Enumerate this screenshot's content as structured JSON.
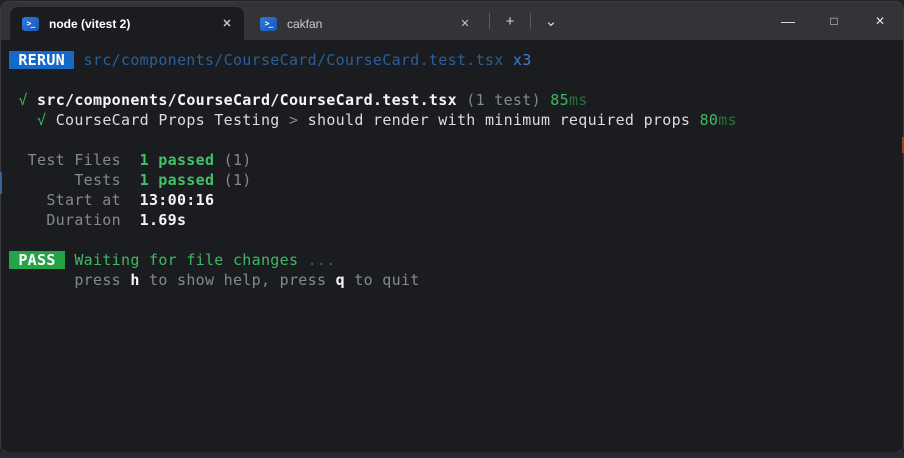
{
  "window": {
    "tabs": [
      {
        "title": "node (vitest 2)",
        "active": true
      },
      {
        "title": "cakfan",
        "active": false
      }
    ]
  },
  "icons": {
    "terminal_glyph": ">_",
    "tab_close": "✕",
    "new_tab": "+",
    "tab_dropdown": "⌄",
    "minimize": "—",
    "maximize": "□",
    "window_close": "✕"
  },
  "colors": {
    "rerun_badge_blue": "#1569c8",
    "pass_badge_green": "#27a347",
    "success_green": "#3fb862",
    "terminal_background": "#1b1c1f",
    "titlebar_background": "#333338"
  },
  "terminal": {
    "lines": [
      {
        "segments": [
          {
            "text": " RERUN ",
            "style": "badge-rerun"
          },
          {
            "text": " ",
            "style": "plain"
          },
          {
            "text": "src/components/CourseCard/CourseCard.test.tsx",
            "style": "blue-dim"
          },
          {
            "text": " ",
            "style": "plain"
          },
          {
            "text": "x3",
            "style": "blue"
          }
        ]
      },
      {
        "segments": []
      },
      {
        "segments": [
          {
            "text": " ",
            "style": "plain"
          },
          {
            "text": "√",
            "style": "green"
          },
          {
            "text": " ",
            "style": "plain"
          },
          {
            "text": "src/components/CourseCard/CourseCard.test.tsx",
            "style": "white-bold"
          },
          {
            "text": " ",
            "style": "plain"
          },
          {
            "text": "(1 test)",
            "style": "gray"
          },
          {
            "text": " ",
            "style": "plain"
          },
          {
            "text": "85",
            "style": "green"
          },
          {
            "text": "ms",
            "style": "green-dim"
          }
        ]
      },
      {
        "segments": [
          {
            "text": "   ",
            "style": "plain"
          },
          {
            "text": "√",
            "style": "green"
          },
          {
            "text": " ",
            "style": "plain"
          },
          {
            "text": "CourseCard Props Testing",
            "style": "white"
          },
          {
            "text": " ",
            "style": "plain"
          },
          {
            "text": ">",
            "style": "gray"
          },
          {
            "text": " ",
            "style": "plain"
          },
          {
            "text": "should render with minimum required props",
            "style": "white"
          },
          {
            "text": " ",
            "style": "plain"
          },
          {
            "text": "80",
            "style": "green"
          },
          {
            "text": "ms",
            "style": "green-dim"
          }
        ]
      },
      {
        "segments": []
      },
      {
        "segments": [
          {
            "text": "  Test Files  ",
            "style": "gray"
          },
          {
            "text": "1 passed",
            "style": "green-bold"
          },
          {
            "text": " ",
            "style": "plain"
          },
          {
            "text": "(1)",
            "style": "gray"
          }
        ]
      },
      {
        "segments": [
          {
            "text": "       Tests  ",
            "style": "gray"
          },
          {
            "text": "1 passed",
            "style": "green-bold"
          },
          {
            "text": " ",
            "style": "plain"
          },
          {
            "text": "(1)",
            "style": "gray"
          }
        ]
      },
      {
        "segments": [
          {
            "text": "    Start at  ",
            "style": "gray"
          },
          {
            "text": "13:00:16",
            "style": "white-bold"
          }
        ]
      },
      {
        "segments": [
          {
            "text": "    Duration  ",
            "style": "gray"
          },
          {
            "text": "1.69s",
            "style": "white-bold"
          }
        ]
      },
      {
        "segments": []
      },
      {
        "segments": [
          {
            "text": " PASS ",
            "style": "badge-pass"
          },
          {
            "text": " ",
            "style": "plain"
          },
          {
            "text": "Waiting for file changes",
            "style": "green"
          },
          {
            "text": " ...",
            "style": "green-dim"
          }
        ]
      },
      {
        "segments": [
          {
            "text": "       ",
            "style": "plain"
          },
          {
            "text": "press ",
            "style": "gray"
          },
          {
            "text": "h",
            "style": "white-bold"
          },
          {
            "text": " to show help, press ",
            "style": "gray"
          },
          {
            "text": "q",
            "style": "white-bold"
          },
          {
            "text": " to quit",
            "style": "gray"
          }
        ]
      }
    ]
  }
}
